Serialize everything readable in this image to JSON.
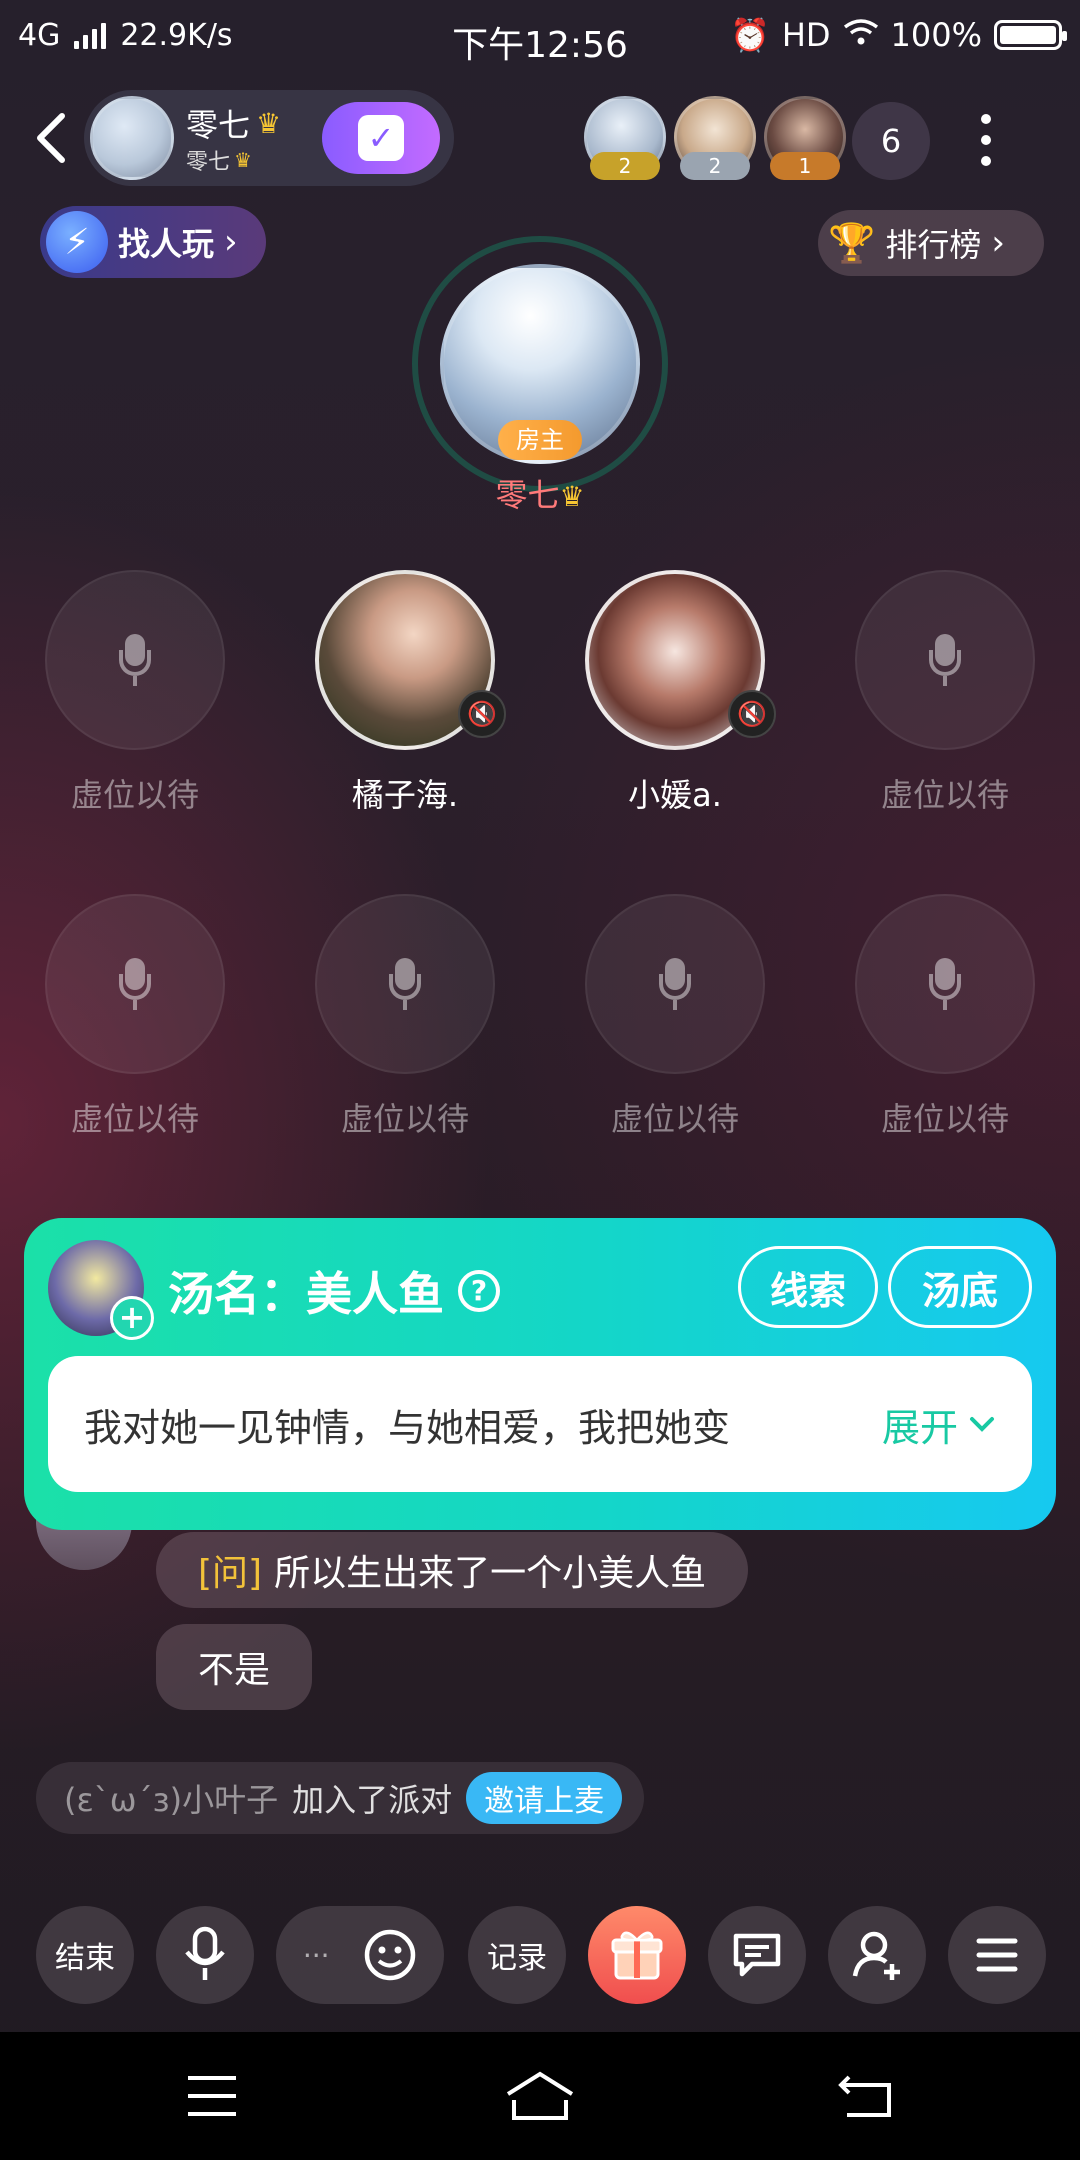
{
  "status": {
    "network": "4G",
    "speed": "22.9K/s",
    "time": "下午12:56",
    "hd": "HD",
    "battery": "100%"
  },
  "room": {
    "title": "零七",
    "subtitle": "零七",
    "audience": [
      {
        "badge": "2",
        "color": "#c7a22a"
      },
      {
        "badge": "2",
        "color": "#9aa4b0"
      },
      {
        "badge": "1",
        "color": "#c77a2a"
      }
    ],
    "audience_count": "6"
  },
  "actions": {
    "find_label": "找人玩",
    "rank_label": "排行榜"
  },
  "host": {
    "tag": "房主",
    "name": "零七"
  },
  "seats": [
    {
      "label": "虚位以待",
      "occupied": false
    },
    {
      "label": "橘子海.",
      "occupied": true,
      "muted": true
    },
    {
      "label": "小媛a.",
      "occupied": true,
      "muted": true
    },
    {
      "label": "虚位以待",
      "occupied": false
    },
    {
      "label": "虚位以待",
      "occupied": false
    },
    {
      "label": "虚位以待",
      "occupied": false
    },
    {
      "label": "虚位以待",
      "occupied": false
    },
    {
      "label": "虚位以待",
      "occupied": false
    }
  ],
  "soup": {
    "title": "汤名：美人鱼",
    "clue_button": "线索",
    "answer_button": "汤底",
    "text": "我对她一见钟情，与她相爱，我把她变",
    "expand": "展开"
  },
  "chat": {
    "question_tag": "[问]",
    "question_text": "所以生出来了一个小美人鱼",
    "reply": "不是",
    "system": {
      "name": "(ε`ω´з)小叶子",
      "action": "加入了派对",
      "invite": "邀请上麦"
    }
  },
  "toolbar": {
    "end": "结束",
    "dots": "···",
    "record": "记录"
  },
  "colors": {
    "card_gradient_start": "#1be0a8",
    "card_gradient_end": "#16c9f0",
    "host_name": "#ff7a7a",
    "invite": "#39b8f5"
  }
}
